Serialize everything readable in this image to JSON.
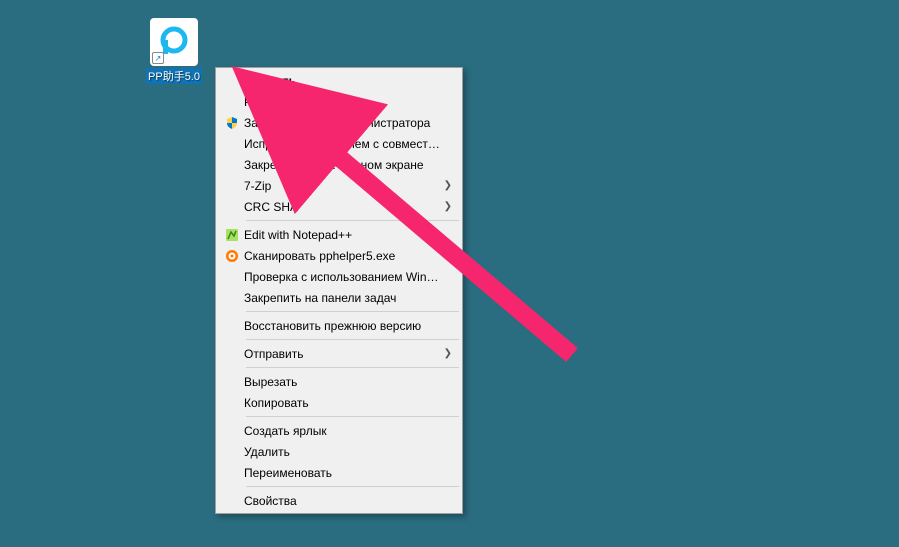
{
  "desktop_icon": {
    "label": "PP助手5.0"
  },
  "context_menu": {
    "items": [
      {
        "label": "Открыть",
        "bold": true,
        "icon": null,
        "submenu": false
      },
      {
        "label": "Расположение файла",
        "bold": false,
        "icon": null,
        "submenu": false
      },
      {
        "label": "Запуск от имени администратора",
        "bold": false,
        "icon": "shield",
        "submenu": false
      },
      {
        "label": "Исправление проблем с совместимостью",
        "bold": false,
        "icon": null,
        "submenu": false
      },
      {
        "label": "Закрепить на начальном экране",
        "bold": false,
        "icon": null,
        "submenu": false
      },
      {
        "label": "7-Zip",
        "bold": false,
        "icon": null,
        "submenu": true
      },
      {
        "label": "CRC SHA",
        "bold": false,
        "icon": null,
        "submenu": true
      },
      "---",
      {
        "label": "Edit with Notepad++",
        "bold": false,
        "icon": "notepadpp",
        "submenu": false
      },
      {
        "label": "Сканировать pphelper5.exe",
        "bold": false,
        "icon": "avast",
        "submenu": false
      },
      {
        "label": "Проверка с использованием Windows Defender...",
        "bold": false,
        "icon": null,
        "submenu": false
      },
      {
        "label": "Закрепить на панели задач",
        "bold": false,
        "icon": null,
        "submenu": false
      },
      "---",
      {
        "label": "Восстановить прежнюю версию",
        "bold": false,
        "icon": null,
        "submenu": false
      },
      "---",
      {
        "label": "Отправить",
        "bold": false,
        "icon": null,
        "submenu": true
      },
      "---",
      {
        "label": "Вырезать",
        "bold": false,
        "icon": null,
        "submenu": false
      },
      {
        "label": "Копировать",
        "bold": false,
        "icon": null,
        "submenu": false
      },
      "---",
      {
        "label": "Создать ярлык",
        "bold": false,
        "icon": null,
        "submenu": false
      },
      {
        "label": "Удалить",
        "bold": false,
        "icon": null,
        "submenu": false
      },
      {
        "label": "Переименовать",
        "bold": false,
        "icon": null,
        "submenu": false
      },
      "---",
      {
        "label": "Свойства",
        "bold": false,
        "icon": null,
        "submenu": false
      }
    ]
  },
  "annotation": {
    "target_item_index": 2,
    "color": "#f5266e"
  }
}
